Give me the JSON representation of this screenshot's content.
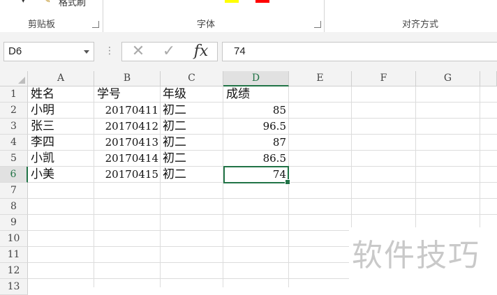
{
  "ribbon": {
    "format_painter_label": "格式刷",
    "groups": [
      {
        "label": "剪贴板"
      },
      {
        "label": "字体"
      },
      {
        "label": "对齐方式"
      }
    ],
    "font_color_swatches": [
      "#ffff00",
      "#ff0000"
    ]
  },
  "formula_bar": {
    "name_box": "D6",
    "cancel_symbol": "✕",
    "enter_symbol": "✓",
    "fx_symbol": "fx",
    "value": "74"
  },
  "columns": [
    "A",
    "B",
    "C",
    "D",
    "E",
    "F",
    "G"
  ],
  "rows": [
    "1",
    "2",
    "3",
    "4",
    "5",
    "6",
    "7",
    "8",
    "9",
    "10",
    "11",
    "12",
    "13"
  ],
  "selected_cell": "D6",
  "sheet": {
    "headers": [
      "姓名",
      "学号",
      "年级",
      "成绩"
    ],
    "records": [
      {
        "name": "小明",
        "id": "20170411",
        "grade": "初二",
        "score": "85"
      },
      {
        "name": "张三",
        "id": "20170412",
        "grade": "初二",
        "score": "96.5"
      },
      {
        "name": "李四",
        "id": "20170413",
        "grade": "初二",
        "score": "87"
      },
      {
        "name": "小凯",
        "id": "20170414",
        "grade": "初二",
        "score": "86.5"
      },
      {
        "name": "小美",
        "id": "20170415",
        "grade": "初二",
        "score": "74"
      }
    ]
  },
  "watermark": "软件技巧",
  "colors": {
    "accent": "#217346",
    "header_bg": "#f3f3f3",
    "gridline": "#dcdcdc"
  }
}
